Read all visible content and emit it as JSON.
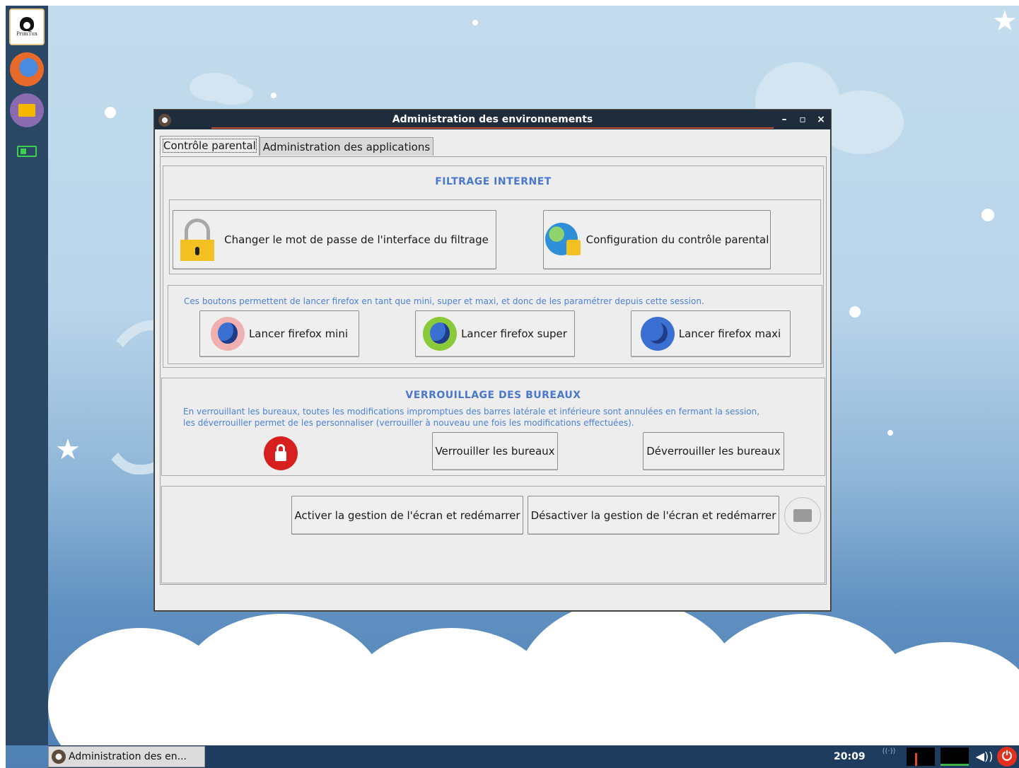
{
  "dock": {
    "logo_label": "PrimTux"
  },
  "window": {
    "title": "Administration des environnements",
    "controls": {
      "minimize": "–",
      "maximize": "▫",
      "close": "×"
    },
    "tabs": [
      {
        "label": "Contrôle parental",
        "active": true
      },
      {
        "label": "Administration des applications",
        "active": false
      }
    ],
    "filtering": {
      "title": "FILTRAGE INTERNET",
      "change_password_label": "Changer le mot de passe de l'interface du filtrage",
      "parental_config_label": "Configuration du contrôle parental"
    },
    "firefox": {
      "hint": "Ces boutons permettent de lancer firefox en tant que mini, super et maxi, et donc de les paramétrer depuis cette session.",
      "mini_label": "Lancer firefox mini",
      "super_label": "Lancer firefox super",
      "maxi_label": "Lancer firefox maxi"
    },
    "lock": {
      "title": "VERROUILLAGE DES BUREAUX",
      "hint_line1": "En verrouillant les bureaux, toutes les modifications impromptues des barres latérale et inférieure sont annulées en fermant la session,",
      "hint_line2": "les déverrouiller permet de les personnaliser (verrouiller à nouveau une fois les modifications effectuées).",
      "lock_label": "Verrouiller les bureaux",
      "unlock_label": "Déverrouiller les bureaux"
    },
    "screen": {
      "activate_label": "Activer la gestion de l'écran et redémarrer",
      "deactivate_label": "Désactiver la gestion de l'écran et redémarrer"
    }
  },
  "taskbar": {
    "task_label": "Administration des en...",
    "clock": "20:09",
    "volume_glyph": "◀))",
    "power_glyph": "⏻"
  }
}
